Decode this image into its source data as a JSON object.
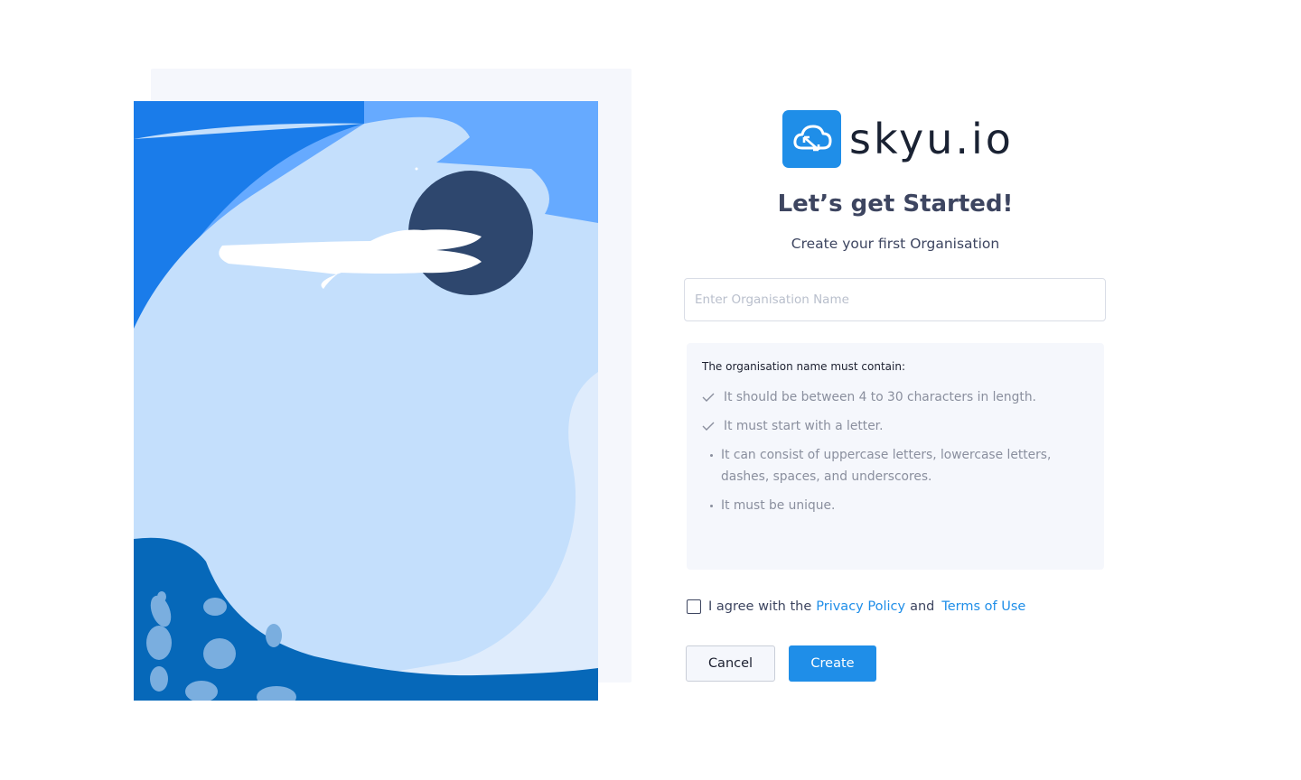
{
  "brand": {
    "name": "skyu.io",
    "logo_icon": "cloud-sync-icon",
    "accent": "#1f8ee8"
  },
  "heading": {
    "title": "Let’s get Started!",
    "subtitle": "Create your first Organisation"
  },
  "org_input": {
    "placeholder": "Enter Organisation Name",
    "value": ""
  },
  "rules": {
    "header": "The organisation name must contain:",
    "items": [
      {
        "text": "It should be between 4 to 30 characters in length.",
        "marker": "check"
      },
      {
        "text": "It must start with a letter.",
        "marker": "check"
      },
      {
        "text": "It can consist of uppercase letters, lowercase letters, dashes, spaces, and underscores.",
        "marker": "bullet"
      },
      {
        "text": "It must be unique.",
        "marker": "bullet"
      }
    ]
  },
  "agreement": {
    "prefix": "I agree with the",
    "privacy": "Privacy Policy",
    "and": "and",
    "terms": "Terms of Use",
    "checked": false
  },
  "buttons": {
    "cancel": "Cancel",
    "create": "Create"
  }
}
